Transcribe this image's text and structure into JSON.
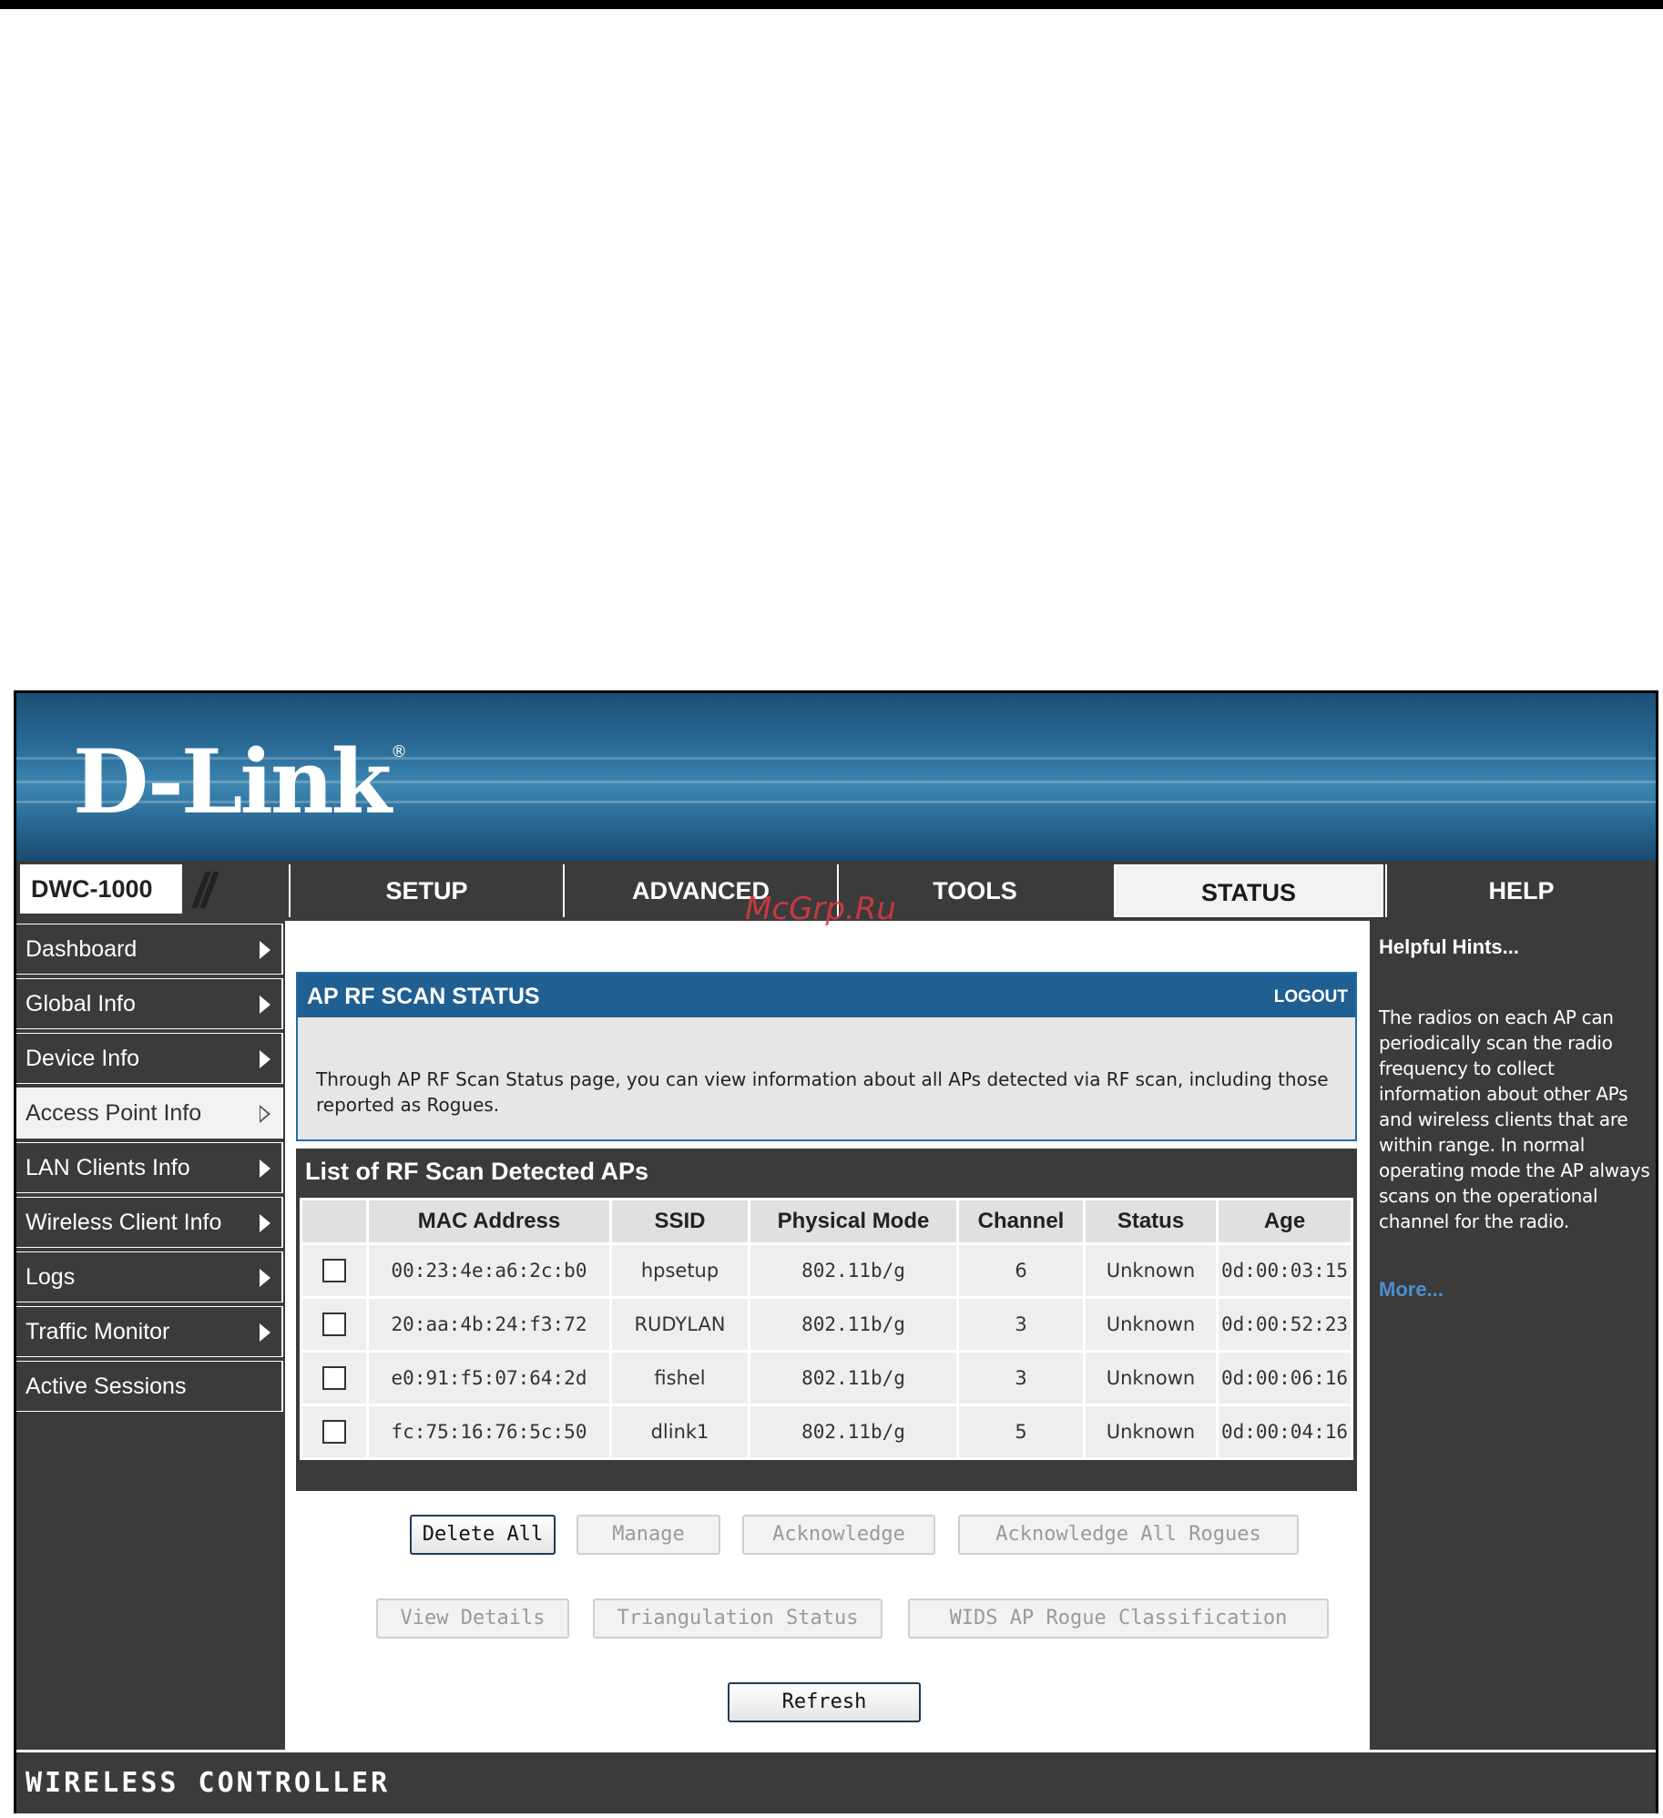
{
  "header": {
    "logo": "D-Link"
  },
  "model": {
    "label": "DWC-1000"
  },
  "nav": {
    "tabs": [
      {
        "label": "SETUP"
      },
      {
        "label": "ADVANCED"
      },
      {
        "label": "TOOLS"
      },
      {
        "label": "STATUS",
        "active": true
      },
      {
        "label": "HELP"
      }
    ]
  },
  "sidebar": {
    "items": [
      {
        "label": "Dashboard"
      },
      {
        "label": "Global Info"
      },
      {
        "label": "Device Info"
      },
      {
        "label": "Access Point Info",
        "active": true
      },
      {
        "label": "LAN Clients Info"
      },
      {
        "label": "Wireless Client Info"
      },
      {
        "label": "Logs"
      },
      {
        "label": "Traffic Monitor"
      },
      {
        "label": "Active Sessions"
      }
    ]
  },
  "panel": {
    "title": "AP RF SCAN STATUS",
    "logout": "LOGOUT",
    "description": "Through AP RF Scan Status page, you can view information about all APs detected via RF scan, including those reported as Rogues."
  },
  "list": {
    "title": "List of RF Scan Detected APs",
    "columns": [
      "MAC Address",
      "SSID",
      "Physical Mode",
      "Channel",
      "Status",
      "Age"
    ],
    "rows": [
      {
        "mac": "00:23:4e:a6:2c:b0",
        "ssid": "hpsetup",
        "mode": "802.11b/g",
        "channel": "6",
        "status": "Unknown",
        "age": "0d:00:03:15"
      },
      {
        "mac": "20:aa:4b:24:f3:72",
        "ssid": "RUDYLAN",
        "mode": "802.11b/g",
        "channel": "3",
        "status": "Unknown",
        "age": "0d:00:52:23"
      },
      {
        "mac": "e0:91:f5:07:64:2d",
        "ssid": "fishel",
        "mode": "802.11b/g",
        "channel": "3",
        "status": "Unknown",
        "age": "0d:00:06:16"
      },
      {
        "mac": "fc:75:16:76:5c:50",
        "ssid": "dlink1",
        "mode": "802.11b/g",
        "channel": "5",
        "status": "Unknown",
        "age": "0d:00:04:16"
      }
    ]
  },
  "buttons": {
    "delete_all": "Delete All",
    "manage": "Manage",
    "acknowledge": "Acknowledge",
    "acknowledge_all": "Acknowledge All Rogues",
    "view_details": "View Details",
    "triangulation": "Triangulation Status",
    "wids": "WIDS AP Rogue Classification",
    "refresh": "Refresh"
  },
  "hints": {
    "title": "Helpful Hints...",
    "text": "The radios on each AP can periodically scan the radio frequency to collect information about other APs and wireless clients that are within range. In normal operating mode the AP always scans on the operational channel for the radio.",
    "more": "More..."
  },
  "footer": {
    "label": "WIRELESS CONTROLLER"
  },
  "watermark": "McGrp.Ru",
  "colors": {
    "header_blue": "#2b6e9a",
    "panel_blue": "#1f5f91",
    "dark_gray": "#3b3b3b",
    "link_blue": "#4d8fd6"
  }
}
